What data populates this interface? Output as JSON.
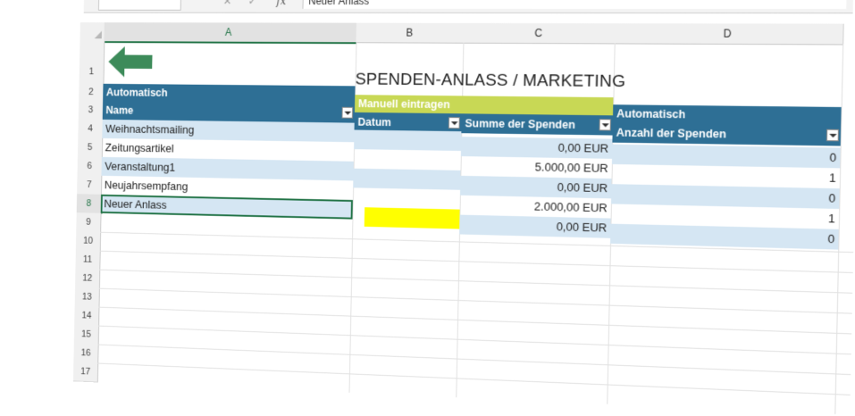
{
  "formula_bar": {
    "content": "Neuer Anlass",
    "fx_label": "fx",
    "cancel_glyph": "✕",
    "enter_glyph": "✓"
  },
  "columns": [
    "A",
    "B",
    "C",
    "D"
  ],
  "rows": [
    "1",
    "2",
    "3",
    "4",
    "5",
    "6",
    "7",
    "8",
    "9",
    "10",
    "11",
    "12",
    "13",
    "14",
    "15",
    "16",
    "17"
  ],
  "sheet": {
    "title": "SPENDEN-ANLASS / MARKETING",
    "band_a": "Automatisch",
    "band_bc": "Manuell eintragen",
    "band_d": "Automatisch",
    "headers": {
      "name": "Name",
      "datum": "Datum",
      "summe": "Summe der Spenden",
      "anzahl": "Anzahl der Spenden"
    },
    "table_rows": [
      {
        "name": "Weihnachtsmailing",
        "datum": "",
        "summe": "0,00 EUR",
        "anzahl": "0"
      },
      {
        "name": "Zeitungsartikel",
        "datum": "",
        "summe": "5.000,00 EUR",
        "anzahl": "1"
      },
      {
        "name": "Veranstaltung1",
        "datum": "",
        "summe": "0,00 EUR",
        "anzahl": "0"
      },
      {
        "name": "Neujahrsempfang",
        "datum": "",
        "summe": "2.000,00 EUR",
        "anzahl": "1"
      },
      {
        "name": "Neuer Anlass",
        "datum": "",
        "summe": "0,00 EUR",
        "anzahl": "0"
      }
    ]
  },
  "colors": {
    "header_band": "#2e6f95",
    "manual_band": "#c8d855",
    "stripe": "#d5e6f3",
    "arrow": "#3d8b5a",
    "selection": "#217346",
    "highlight": "#ffff00"
  },
  "icons": {
    "back_arrow": "arrow-left-icon",
    "filter_dropdown": "chevron-down-icon"
  }
}
